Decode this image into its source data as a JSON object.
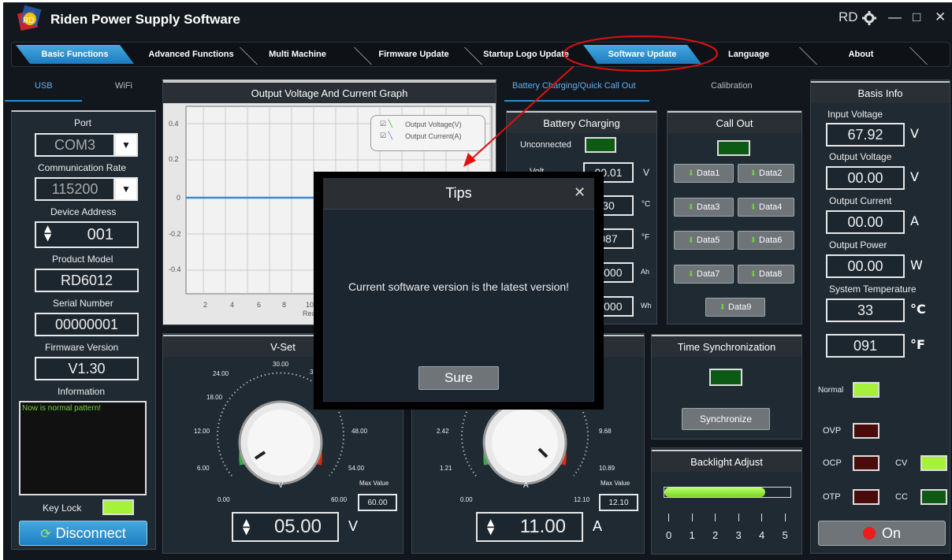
{
  "window": {
    "title": "Riden Power Supply Software",
    "user": "RD",
    "minimize_icon": "—",
    "maximize_icon": "□",
    "close_icon": "✕"
  },
  "tabs": [
    "Basic Functions",
    "Advanced Functions",
    "Multi Machine",
    "Firmware Update",
    "Startup Logo Update",
    "Software Update",
    "Language",
    "About"
  ],
  "conn_tabs": [
    "USB",
    "WiFi"
  ],
  "left": {
    "port_label": "Port",
    "port": "COM3",
    "rate_label": "Communication Rate",
    "rate": "115200",
    "addr_label": "Device Address",
    "addr": "001",
    "model_label": "Product Model",
    "model": "RD6012",
    "serial_label": "Serial Number",
    "serial": "00000001",
    "fw_label": "Firmware Version",
    "fw": "V1.30",
    "info_label": "Information",
    "info_text": "Now is normal pattern!",
    "keylock": "Key Lock",
    "disconnect": "Disconnect"
  },
  "graph": {
    "title": "Output Voltage And Current Graph",
    "legend_v": "Output Voltage(V)",
    "legend_c": "Output Current(A)",
    "y_ticks": [
      "0.4",
      "0.2",
      "0",
      "-0.2",
      "-0.4"
    ],
    "x_ticks": [
      "2",
      "4",
      "6",
      "8",
      "10"
    ],
    "x_label": "Rea"
  },
  "mid_tabs": [
    "Battery Charging/Quick Call Out",
    "Calibration"
  ],
  "battery": {
    "title": "Battery Charging",
    "status": "Unconnected",
    "voltage": "00.01",
    "voltage_unit": "V",
    "temp_c": "30",
    "temp_c_unit": "°C",
    "temp_f": "087",
    "temp_f_unit": "°F",
    "ah": "0.000",
    "ah_unit": "Ah",
    "wh": "0.000",
    "wh_unit": "Wh",
    "volt_label": "Volt"
  },
  "callout": {
    "title": "Call Out",
    "buttons": [
      "Data1",
      "Data2",
      "Data3",
      "Data4",
      "Data5",
      "Data6",
      "Data7",
      "Data8",
      "Data9"
    ]
  },
  "time_sync": {
    "title": "Time Synchronization",
    "button": "Synchronize"
  },
  "backlight": {
    "title": "Backlight Adjust",
    "ticks": [
      "0",
      "1",
      "2",
      "3",
      "4",
      "5"
    ],
    "level": 0.8
  },
  "vset": {
    "title": "V-Set",
    "value": "05.00",
    "unit": "V",
    "dial_unit": "V",
    "max_label": "Max Value",
    "max": "60.00",
    "scale": [
      "0.00",
      "6.00",
      "12.00",
      "18.00",
      "24.00",
      "30.00",
      "36",
      "48.00",
      "54.00",
      "60.00"
    ]
  },
  "iset": {
    "value": "11.00",
    "unit": "A",
    "dial_unit": "A",
    "max_label": "Max Value",
    "max": "12.10",
    "scale": [
      "0.00",
      "1.21",
      "2.42",
      "9.68",
      "10.89",
      "12.10"
    ]
  },
  "basis": {
    "title": "Basis Info",
    "in_v_label": "Input Voltage",
    "in_v": "67.92",
    "in_v_unit": "V",
    "out_v_label": "Output Voltage",
    "out_v": "00.00",
    "out_v_unit": "V",
    "out_c_label": "Output Current",
    "out_c": "00.00",
    "out_c_unit": "A",
    "out_p_label": "Output Power",
    "out_p": "00.00",
    "out_p_unit": "W",
    "temp_label": "System Temperature",
    "temp_c": "33",
    "temp_c_unit": "°C",
    "temp_f": "091",
    "temp_f_unit": "°F",
    "normal": "Normal",
    "ovp": "OVP",
    "ocp": "OCP",
    "otp": "OTP",
    "cv": "CV",
    "cc": "CC",
    "on": "On"
  },
  "dialog": {
    "title": "Tips",
    "message": "Current software version is the latest version!",
    "button": "Sure",
    "close": "✕"
  },
  "colors": {
    "accent": "#2f8fd0",
    "led_green": "#a6f23a",
    "led_off_green": "#0c5a14",
    "led_red": "#4a0b0b",
    "highlight": "#e01010"
  }
}
